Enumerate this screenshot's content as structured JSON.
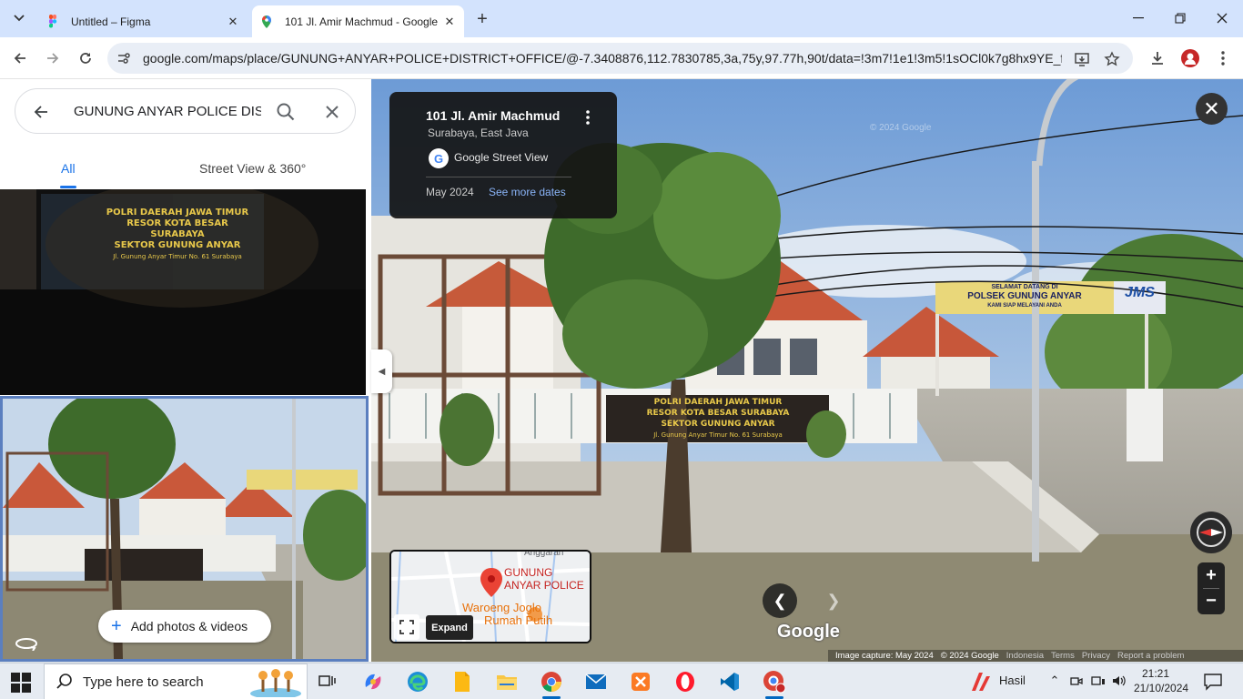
{
  "browser": {
    "tabs": [
      {
        "title": "Untitled – Figma"
      },
      {
        "title": "101 Jl. Amir Machmud - Google Maps"
      }
    ],
    "url": "google.com/maps/place/GUNUNG+ANYAR+POLICE+DISTRICT+OFFICE/@-7.3408876,112.7830785,3a,75y,97.77h,90t/data=!3m7!1e1!3m5!1sOCl0k7g8hx9YE_faQe..."
  },
  "maps": {
    "search": {
      "query": "GUNUNG ANYAR POLICE DISTRICT OFFICE"
    },
    "tabs": {
      "all": "All",
      "street_view": "Street View & 360°"
    },
    "add_photos": "Add photos & videos",
    "info_card": {
      "address": "101 Jl. Amir Machmud",
      "city": "Surabaya, East Java",
      "source": "Google Street View",
      "date": "May 2024",
      "see_more": "See more dates"
    },
    "minimap": {
      "place_label": "GUNUNG ANYAR POLICE",
      "nearby_label_1": "Waroeng Joglo",
      "nearby_label_2": "Rumah Putih",
      "street_label": "Anggaran",
      "expand_tooltip": "Expand"
    },
    "photo1_sign": [
      "POLRI DAERAH JAWA TIMUR",
      "RESOR KOTA BESAR SURABAYA",
      "SEKTOR GUNUNG ANYAR",
      "Jl. Gunung Anyar Timur No. 61 Surabaya"
    ],
    "scene_signs": {
      "welcome": [
        "SELAMAT DATANG DI",
        "POLSEK GUNUNG ANYAR",
        "KAMI SIAP MELAYANI ANDA"
      ],
      "jms": "JMS",
      "front": [
        "POLRI DAERAH JAWA TIMUR",
        "RESOR KOTA BESAR SURABAYA",
        "SEKTOR GUNUNG ANYAR",
        "Jl. Gunung Anyar Timur No. 61 Surabaya"
      ]
    },
    "google_logo": "Google",
    "watermark": "© 2024 Google",
    "credits": {
      "capture": "Image capture: May 2024",
      "copyright": "© 2024 Google",
      "indonesia": "Indonesia",
      "terms": "Terms",
      "privacy": "Privacy",
      "report": "Report a problem"
    }
  },
  "taskbar": {
    "search_placeholder": "Type here to search",
    "weather_label": "Hasil",
    "time": "21:21",
    "date": "21/10/2024"
  }
}
